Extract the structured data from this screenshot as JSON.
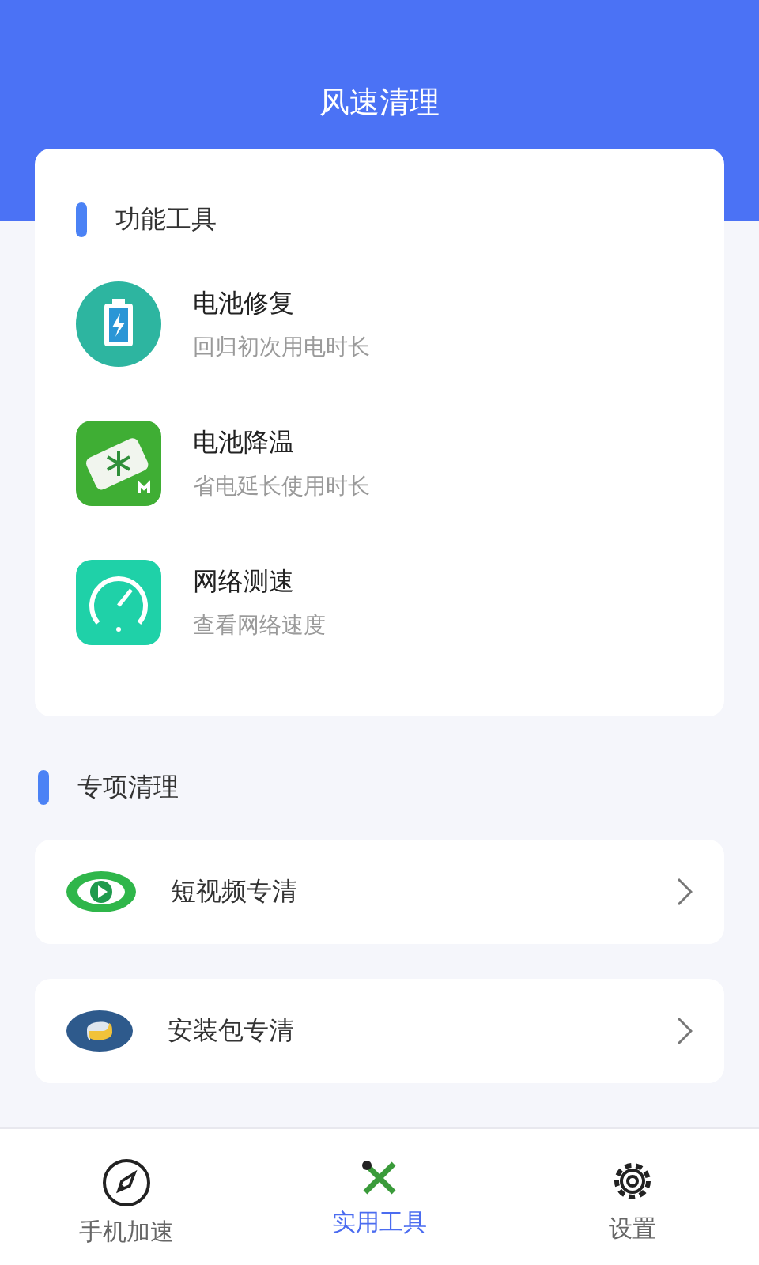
{
  "header": {
    "title": "风速清理"
  },
  "tools_section": {
    "title": "功能工具",
    "items": [
      {
        "kind": "battery",
        "title": "电池修复",
        "subtitle": "回归初次用电时长"
      },
      {
        "kind": "cooling",
        "title": "电池降温",
        "subtitle": "省电延长使用时长"
      },
      {
        "kind": "speed",
        "title": "网络测速",
        "subtitle": "查看网络速度"
      }
    ]
  },
  "special_section": {
    "title": "专项清理",
    "items": [
      {
        "kind": "video",
        "label": "短视频专清"
      },
      {
        "kind": "package",
        "label": "安装包专清"
      }
    ]
  },
  "bottom_nav": [
    {
      "kind": "rocket",
      "label": "手机加速",
      "selected": false
    },
    {
      "kind": "tools",
      "label": "实用工具",
      "selected": true
    },
    {
      "kind": "gear",
      "label": "设置",
      "selected": false
    }
  ]
}
